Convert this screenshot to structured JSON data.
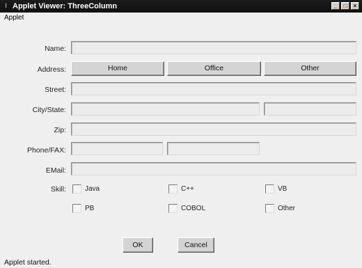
{
  "window": {
    "title": "Applet Viewer: ThreeColumn"
  },
  "menubar": {
    "items": [
      "Applet"
    ]
  },
  "form": {
    "name_label": "Name:",
    "address_label": "Address:",
    "address_buttons": [
      "Home",
      "Office",
      "Other"
    ],
    "street_label": "Street:",
    "citystate_label": "City/State:",
    "zip_label": "Zip:",
    "phonefax_label": "Phone/FAX:",
    "email_label": "EMail:",
    "skill_label": "Skill:",
    "skills": [
      "Java",
      "C++",
      "VB",
      "PB",
      "COBOL",
      "Other"
    ],
    "ok_label": "OK",
    "cancel_label": "Cancel"
  },
  "status": {
    "text": "Applet started."
  }
}
